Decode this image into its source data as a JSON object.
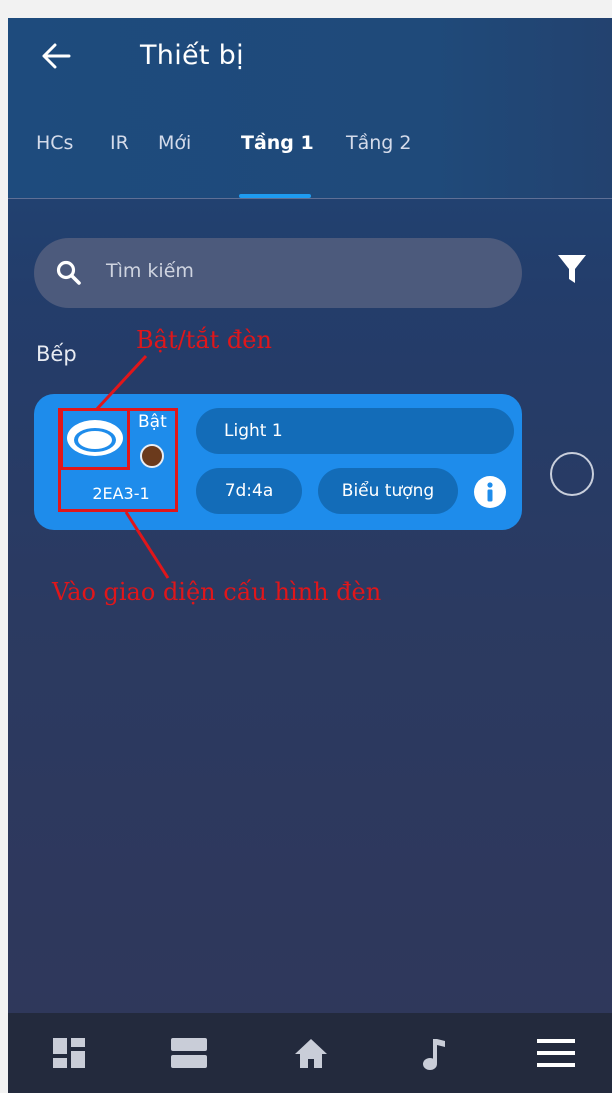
{
  "header": {
    "title": "Thiết bị",
    "back_icon": "arrow-left-icon"
  },
  "tabs": [
    {
      "label": "HCs",
      "active": false
    },
    {
      "label": "IR",
      "active": false
    },
    {
      "label": "Mới",
      "active": false
    },
    {
      "label": "Tầng 1",
      "active": true
    },
    {
      "label": "Tầng 2",
      "active": false
    }
  ],
  "search": {
    "placeholder": "Tìm kiếm",
    "icon": "search-icon"
  },
  "filter": {
    "icon": "filter-icon"
  },
  "section": {
    "label": "Bếp"
  },
  "device": {
    "state": "Bật",
    "code": "2EA3-1",
    "name": "Light 1",
    "address": "7d:4a",
    "icon_button": "Biểu tượng",
    "info_icon": "info-icon",
    "lamp_icon": "ceiling-light-icon"
  },
  "annotations": {
    "toggle_label": "Bật/tắt đèn",
    "config_label": "Vào giao diện cấu hình đèn"
  },
  "bottom_nav": {
    "items": [
      "dashboard-icon",
      "panels-icon",
      "home-icon",
      "music-icon",
      "menu-icon"
    ]
  },
  "colors": {
    "background_top": "#1f4a7a",
    "background_bottom": "#30375a",
    "card": "#1e8ceb",
    "pill": "#136cb8",
    "tab_indicator": "#1e9bf0",
    "annotation": "#e0161a",
    "bottom_nav": "#232a3d"
  }
}
